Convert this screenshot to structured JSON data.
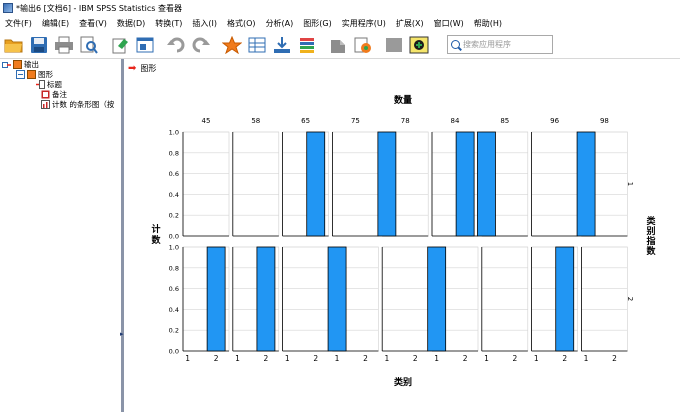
{
  "window": {
    "title": "*输出6 [文档6] - IBM SPSS Statistics 查看器"
  },
  "menu": [
    "文件(F)",
    "编辑(E)",
    "查看(V)",
    "数据(D)",
    "转换(T)",
    "插入(I)",
    "格式(O)",
    "分析(A)",
    "图形(G)",
    "实用程序(U)",
    "扩展(X)",
    "窗口(W)",
    "帮助(H)"
  ],
  "toolbar": {
    "buttons": [
      "open-folder",
      "save-disk",
      "print",
      "print-preview",
      "export",
      "recall-dialog",
      "undo",
      "redo",
      "goto-data",
      "goto-case",
      "goto-variable",
      "variables",
      "insert-new",
      "pivot",
      "designate-window",
      "select-last-output",
      "show-all"
    ],
    "search_placeholder": "搜索应用程序"
  },
  "outline": {
    "root": "输出",
    "graph": "图形",
    "children": [
      "标题",
      "备注",
      "计数 的条形图（按"
    ]
  },
  "main": {
    "header": "图形"
  },
  "chart_data": {
    "type": "bar",
    "title": "数量",
    "xlabel": "类别",
    "ylabel": "计数",
    "row_title": "类别指数",
    "columns": [
      "45",
      "58",
      "65",
      "75",
      "78",
      "84",
      "85",
      "96",
      "98"
    ],
    "rows": [
      "1",
      "2"
    ],
    "categories": [
      "1",
      "2"
    ],
    "ylim": [
      0,
      1.0
    ],
    "yticks": [
      "0.0",
      "0.2",
      "0.4",
      "0.6",
      "0.8",
      "1.0"
    ],
    "bar_color": "#2196f3",
    "panels": [
      {
        "column": "45",
        "row": "1",
        "values": [
          0,
          0
        ]
      },
      {
        "column": "58",
        "row": "1",
        "values": [
          0,
          0
        ]
      },
      {
        "column": "65",
        "row": "1",
        "values": [
          0,
          1
        ]
      },
      {
        "column": "75",
        "row": "1",
        "values": [
          0,
          0
        ]
      },
      {
        "column": "78",
        "row": "1",
        "values": [
          1,
          0
        ]
      },
      {
        "column": "84",
        "row": "1",
        "values": [
          0,
          1
        ]
      },
      {
        "column": "85",
        "row": "1",
        "values": [
          1,
          0
        ]
      },
      {
        "column": "96",
        "row": "1",
        "values": [
          0,
          0
        ]
      },
      {
        "column": "98",
        "row": "1",
        "values": [
          1,
          0
        ]
      },
      {
        "column": "45",
        "row": "2",
        "values": [
          0,
          1
        ]
      },
      {
        "column": "58",
        "row": "2",
        "values": [
          0,
          1
        ]
      },
      {
        "column": "65",
        "row": "2",
        "values": [
          0,
          0
        ]
      },
      {
        "column": "75",
        "row": "2",
        "values": [
          1,
          0
        ]
      },
      {
        "column": "78",
        "row": "2",
        "values": [
          0,
          0
        ]
      },
      {
        "column": "84",
        "row": "2",
        "values": [
          1,
          0
        ]
      },
      {
        "column": "85",
        "row": "2",
        "values": [
          0,
          0
        ]
      },
      {
        "column": "96",
        "row": "2",
        "values": [
          0,
          1
        ]
      },
      {
        "column": "98",
        "row": "2",
        "values": [
          0,
          0
        ]
      }
    ]
  }
}
